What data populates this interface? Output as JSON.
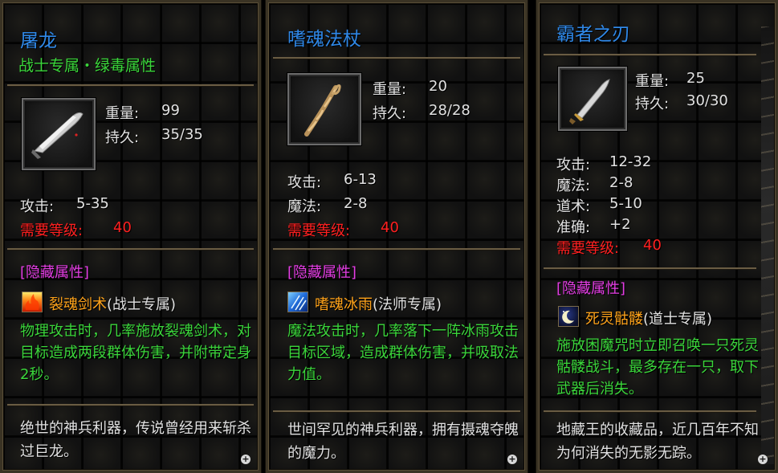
{
  "panels": [
    {
      "title": "屠龙",
      "subtitle": "战士专属・绿毒属性",
      "item_icon": "blade-sword-icon",
      "weight_label": "重量:",
      "weight": "99",
      "durability_label": "持久:",
      "durability": "35/35",
      "stats": [
        {
          "label": "攻击:",
          "value": "5-35"
        }
      ],
      "req_label": "需要等级:",
      "req_value": "40",
      "hidden_header": "[隐藏属性]",
      "skill_icon": "fire-flame-icon",
      "skill_name": "裂魂剑术",
      "skill_class": "(战士专属)",
      "skill_desc": "物理攻击时，几率施放裂魂剑术，对目标造成两段群体伤害，并附带定身2秒。",
      "lore": "绝世的神兵利器，传说曾经用来斩杀过巨龙。"
    },
    {
      "title": "嗜魂法杖",
      "subtitle": "",
      "item_icon": "twisted-staff-icon",
      "weight_label": "重量:",
      "weight": "20",
      "durability_label": "持久:",
      "durability": "28/28",
      "stats": [
        {
          "label": "攻击:",
          "value": "6-13"
        },
        {
          "label": "魔法:",
          "value": "2-8"
        }
      ],
      "req_label": "需要等级:",
      "req_value": "40",
      "hidden_header": "[隐藏属性]",
      "skill_icon": "ice-rain-icon",
      "skill_name": "嗜魂冰雨",
      "skill_class": "(法师专属)",
      "skill_desc": "魔法攻击时，几率落下一阵冰雨攻击目标区域，造成群体伤害，并吸取法力值。",
      "lore": "世间罕见的神兵利器，拥有摄魂夺魄的魔力。"
    },
    {
      "title": "霸者之刃",
      "subtitle": "",
      "item_icon": "short-blade-icon",
      "weight_label": "重量:",
      "weight": "25",
      "durability_label": "持久:",
      "durability": "30/30",
      "stats": [
        {
          "label": "攻击:",
          "value": "12-32"
        },
        {
          "label": "魔法:",
          "value": "2-8"
        },
        {
          "label": "道术:",
          "value": "5-10"
        },
        {
          "label": "准确:",
          "value": "+2"
        }
      ],
      "req_label": "需要等级:",
      "req_value": "40",
      "hidden_header": "[隐藏属性]",
      "skill_icon": "moon-night-icon",
      "skill_name": "死灵骷髅",
      "skill_class": "(道士专属)",
      "skill_desc": "施放困魔咒时立即召唤一只死灵骷髅战斗，最多存在一只，取下武器后消失。",
      "lore": "地藏王的收藏品，近几百年不知为何消失的无影无踪。"
    }
  ],
  "colors": {
    "title": "#2f88e8",
    "subtitle": "#3bd63b",
    "requirement": "#ff2020",
    "hidden_header": "#e43ee4",
    "skill_name": "#ffa31a"
  }
}
